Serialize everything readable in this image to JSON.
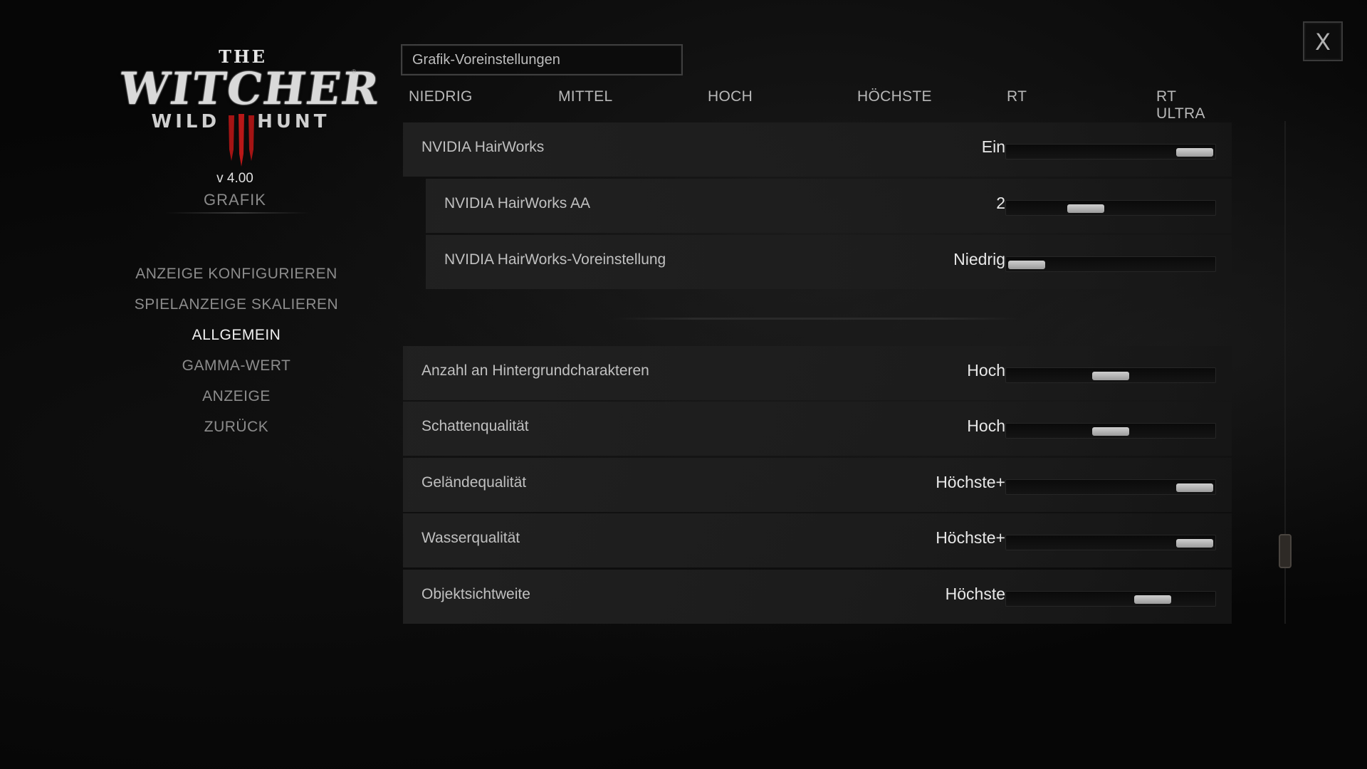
{
  "logo": {
    "the": "THE",
    "main": "WITCHER",
    "reg": "®",
    "sub_left": "WILD",
    "sub_right": "HUNT"
  },
  "version": "v 4.00",
  "section_title": "GRAFIK",
  "menu": {
    "items": [
      {
        "label": "ANZEIGE KONFIGURIEREN",
        "active": false
      },
      {
        "label": "SPIELANZEIGE SKALIEREN",
        "active": false
      },
      {
        "label": "ALLGEMEIN",
        "active": true
      },
      {
        "label": "GAMMA-WERT",
        "active": false
      },
      {
        "label": "ANZEIGE",
        "active": false
      },
      {
        "label": "ZURÜCK",
        "active": false
      }
    ]
  },
  "preset": {
    "label": "Grafik-Voreinstellungen",
    "levels": [
      "NIEDRIG",
      "MITTEL",
      "HOCH",
      "HÖCHSTE",
      "RT",
      "RT ULTRA"
    ]
  },
  "settings": [
    {
      "label": "NVIDIA HairWorks",
      "value": "Ein",
      "level": 1.0
    },
    {
      "label": "NVIDIA HairWorks AA",
      "value": "2",
      "level": 0.35
    },
    {
      "label": "NVIDIA HairWorks-Voreinstellung",
      "value": "Niedrig",
      "level": 0.0
    },
    {
      "label": "Anzahl an Hintergrundcharakteren",
      "value": "Hoch",
      "level": 0.5
    },
    {
      "label": "Schattenqualität",
      "value": "Hoch",
      "level": 0.5
    },
    {
      "label": "Geländequalität",
      "value": "Höchste+",
      "level": 1.0
    },
    {
      "label": "Wasserqualität",
      "value": "Höchste+",
      "level": 1.0
    },
    {
      "label": "Objektsichtweite",
      "value": "Höchste",
      "level": 0.75
    }
  ],
  "close_label": "X",
  "colors": {
    "background": "#060606",
    "row_background": "#222222",
    "text_active": "#f0f0f0",
    "text_inactive": "#8c8c8c",
    "slider_thumb": "#bdbdbd"
  }
}
